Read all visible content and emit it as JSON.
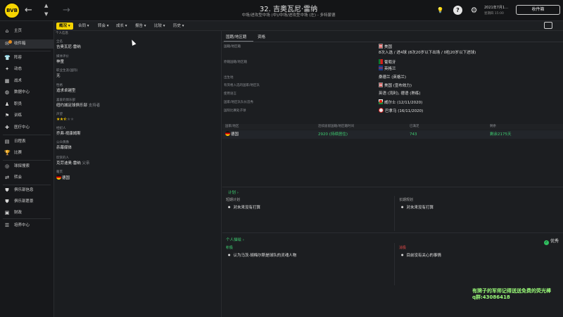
{
  "topbar": {
    "club_badge": "BVB",
    "back_icon": "←",
    "forward_icon": "→",
    "player_title": "32. 吉奥瓦尼·雷纳",
    "player_positions": "中场/进攻型中场 (中)/中场/进攻型中场 (左) - 多特蒙德",
    "date_line1": "2021年7月1…",
    "date_line2": "星期四 15:00",
    "continue_label": "收件箱"
  },
  "submenu": {
    "items": [
      {
        "label": "概况 ▾",
        "active": true
      },
      {
        "label": "合同 ▾"
      },
      {
        "label": "转会 ▾"
      },
      {
        "label": "成长 ▾"
      },
      {
        "label": "报告 ▾"
      },
      {
        "label": "比较 ▾"
      },
      {
        "label": "历史 ▾"
      }
    ]
  },
  "sidebar": {
    "items": [
      {
        "label": "主页",
        "icon": "home-icon"
      },
      {
        "label": "收件箱",
        "icon": "inbox-icon"
      },
      {
        "label": "阵容",
        "icon": "squad-icon"
      },
      {
        "label": "动态",
        "icon": "dynamics-icon"
      },
      {
        "label": "战术",
        "icon": "tactics-icon"
      },
      {
        "label": "数据中心",
        "icon": "data-hub-icon"
      },
      {
        "label": "职员",
        "icon": "staff-icon"
      },
      {
        "label": "训练",
        "icon": "training-icon"
      },
      {
        "label": "医疗中心",
        "icon": "medical-icon"
      },
      {
        "label": "日程表",
        "icon": "schedule-icon"
      },
      {
        "label": "比赛",
        "icon": "competitions-icon"
      },
      {
        "label": "球探搜索",
        "icon": "scouting-icon"
      },
      {
        "label": "转会",
        "icon": "transfers-icon"
      },
      {
        "label": "俱乐部信息",
        "icon": "club-info-icon"
      },
      {
        "label": "俱乐部愿景",
        "icon": "club-vision-icon"
      },
      {
        "label": "财政",
        "icon": "finances-icon"
      },
      {
        "label": "培养中心",
        "icon": "dev-centre-icon"
      }
    ]
  },
  "left_panel": {
    "tab_label": "个人信息",
    "fields": [
      {
        "label": "全名",
        "value": "吉奥瓦尼·雷纳"
      },
      {
        "label": "媒体评价",
        "value": "神童"
      },
      {
        "label": "职业生涯(国际)",
        "value": "无"
      },
      {
        "label": "性格",
        "value": "追求卓越型"
      },
      {
        "label": "喜爱的俱乐部",
        "value": "纽约城足球俱乐部",
        "suffix": "支持者"
      },
      {
        "label": "声望",
        "value": "stars"
      },
      {
        "label": "经纪人",
        "value": "乔弗·视康姆斯"
      },
      {
        "label": "公众偶像",
        "value": "杀幕媒体"
      },
      {
        "label": "欣赏的人",
        "value": "克劳迪奥·雷纳",
        "suffix": "父亲"
      },
      {
        "label": "籍贯",
        "value": "德国"
      }
    ],
    "stars_filled": 2.5,
    "stars_total": 5
  },
  "right_panel": {
    "tabs": [
      "国籍/地区籍",
      "资格"
    ],
    "nat_rows": [
      {
        "label": "国籍/地区籍",
        "value": "美国",
        "flag": "us"
      },
      {
        "label": "",
        "value": "8次入选 / 进4球 (8次20岁以下出场 / 0粒20岁以下进球)",
        "flag": ""
      },
      {
        "label": "原籍国籍/地区籍",
        "value": "葡萄牙",
        "flag": "pt"
      },
      {
        "label": "",
        "value": "英格兰",
        "flag": "gb"
      },
      {
        "label": "出生地",
        "value": "桑德兰 (英格兰)",
        "flag": ""
      },
      {
        "label": "有资格入选的国家/地区队",
        "value": "美国 (宣布效力)",
        "flag": "us"
      },
      {
        "label": "使用语言",
        "value": "英语 (流利), 德语 (熟练)",
        "flag": ""
      },
      {
        "label": "国家/地区队队长首秀",
        "value": "威尔士 (12/11/2020)",
        "flag": "wales"
      },
      {
        "label": "国际比赛处子球",
        "value": "巴拿马 (16/11/2020)",
        "flag": "paris"
      }
    ],
    "table": {
      "headers": [
        "国家/地区",
        "连续居留国籍/地区籍时间",
        "已满足",
        "剩余"
      ],
      "row": [
        "德国",
        "2920 (持续居住)",
        "743",
        "剩余2175天"
      ]
    }
  },
  "plans": {
    "title": "计划 ›",
    "short_label": "短期计划",
    "short_text": "对未来没有打算",
    "long_label": "长期规划",
    "long_text": "对未来没有打算",
    "personal_title": "个人描绘 ›",
    "good_label": "优秀",
    "positive_label": "积极",
    "positive_text": "认为马茨·胡梅尔斯是球队的灵魂人物",
    "negative_label": "消极",
    "negative_text": "目前没有关心的事情"
  },
  "watermark": {
    "line1": "有牌子的军师记得送送免费的荧光棒",
    "line2": "q群:43086418"
  }
}
